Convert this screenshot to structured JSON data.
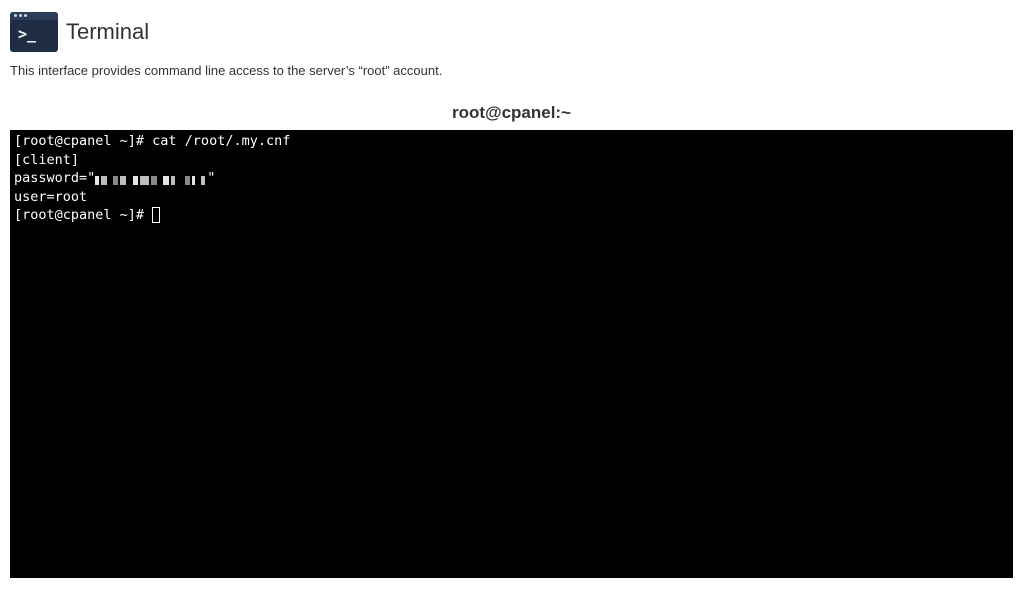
{
  "header": {
    "title": "Terminal",
    "icon": "terminal-prompt-icon"
  },
  "description": "This interface provides command line access to the server’s “root” account.",
  "terminal": {
    "title": "root@cpanel:~",
    "background": "#000000",
    "foreground": "#ffffff",
    "lines": [
      "[root@cpanel ~]# cat /root/.my.cnf",
      "[client]",
      "password=\"",
      "user=root",
      "[root@cpanel ~]# "
    ],
    "password_suffix": "\"",
    "password_redacted": true
  }
}
